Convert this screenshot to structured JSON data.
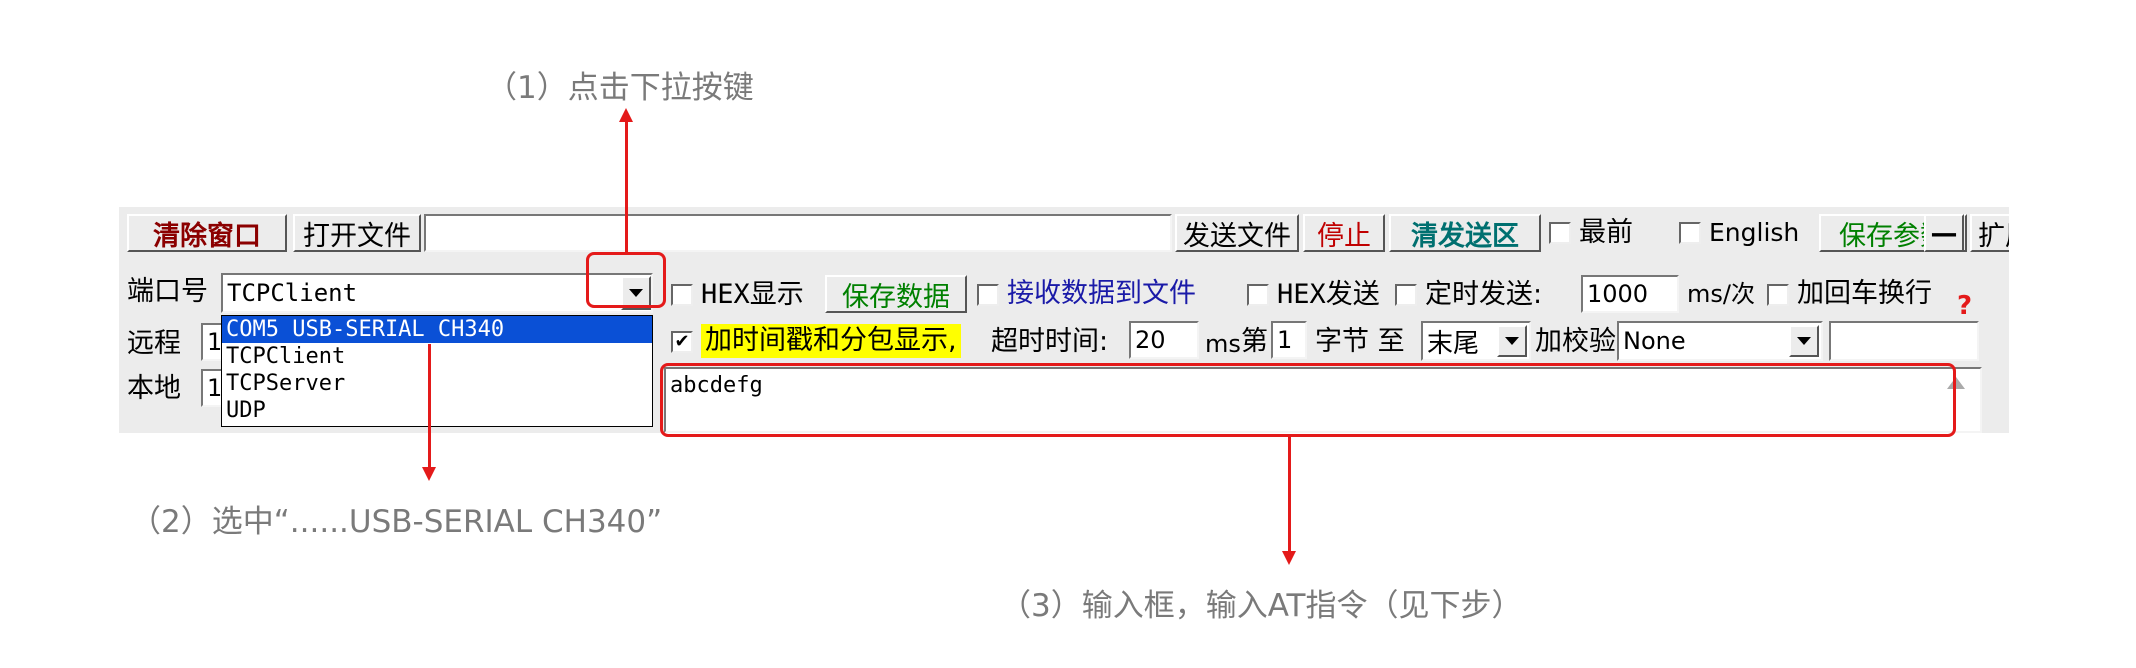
{
  "annotations": {
    "step1": "（1）点击下拉按键",
    "step2": "（2）选中“......USB-SERIAL CH340”",
    "step3": "（3）输入框，输入AT指令（见下步）"
  },
  "toolbar": {
    "clear_window": "清除窗口",
    "open_file": "打开文件",
    "file_path": "",
    "send_file": "发送文件",
    "stop": "停止",
    "clear_send": "清发送区",
    "topmost": "最前",
    "english": "English",
    "save_params": "保存参数",
    "expand": "扩展",
    "minimize": "—"
  },
  "row2": {
    "port_label": "端口号",
    "port_value": "TCPClient",
    "hex_display": "HEX显示",
    "save_data": "保存数据",
    "recv_to_file": "接收数据到文件",
    "hex_send": "HEX发送",
    "timed_send": "定时发送:",
    "interval": "1000",
    "interval_unit": "ms/次",
    "add_crlf": "加回车换行",
    "help": "?"
  },
  "port_options": [
    "COM5 USB-SERIAL CH340",
    "TCPClient",
    "TCPServer",
    "UDP"
  ],
  "row3": {
    "remote_label": "远程",
    "remote_value": "1",
    "timestamp_label": "加时间戳和分包显示,",
    "timeout_label": "超时时间:",
    "timeout_value": "20",
    "timeout_unit": "ms",
    "nth_label": "第",
    "nth_value": "1",
    "byte_label": "字节 至",
    "end_value": "末尾",
    "checksum_label": "加校验",
    "checksum_value": "None"
  },
  "row4": {
    "local_label": "本地",
    "local_value": "1",
    "send_text": "abcdefg"
  },
  "colors": {
    "annotation_red": "#e41a1a",
    "selection_blue": "#0a50d6",
    "highlight_yellow": "#ffff00",
    "label_green": "#008000",
    "label_blue": "#1a1aa8",
    "dark_red": "#8b0000"
  }
}
